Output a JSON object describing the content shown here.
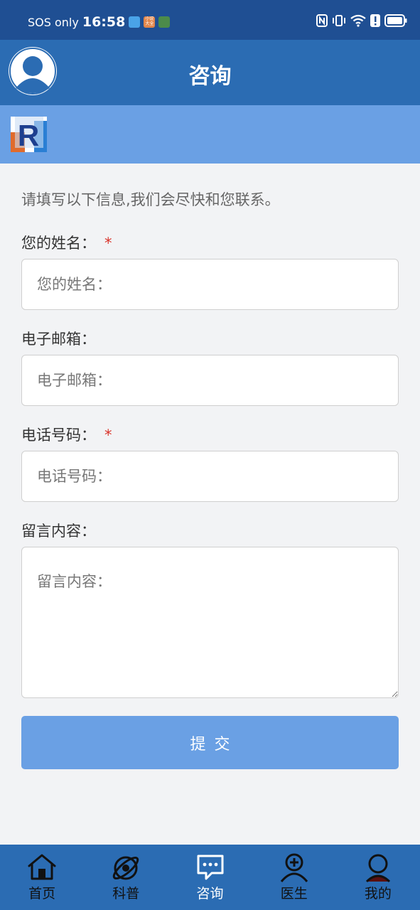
{
  "status_bar": {
    "carrier": "SOS only",
    "time": "16:58",
    "mini_app_labels": [
      "",
      "小说 大全",
      ""
    ]
  },
  "header": {
    "title": "咨询"
  },
  "logo": {
    "letter": "R"
  },
  "form": {
    "intro": "请填写以下信息,我们会尽快和您联系。",
    "required_mark": "*",
    "name": {
      "label": "您的姓名：",
      "placeholder": "您的姓名：",
      "required": true
    },
    "email": {
      "label": "电子邮箱：",
      "placeholder": "电子邮箱：",
      "required": false
    },
    "phone": {
      "label": "电话号码：",
      "placeholder": "电话号码：",
      "required": true
    },
    "message": {
      "label": "留言内容：",
      "placeholder": "留言内容：",
      "required": false
    },
    "submit_label": "提交"
  },
  "tab_bar": {
    "items": [
      {
        "label": "首页",
        "icon": "home-icon",
        "active": false
      },
      {
        "label": "科普",
        "icon": "planet-icon",
        "active": false
      },
      {
        "label": "咨询",
        "icon": "chat-icon",
        "active": true
      },
      {
        "label": "医生",
        "icon": "doctor-icon",
        "active": false
      },
      {
        "label": "我的",
        "icon": "profile-icon",
        "active": false
      }
    ]
  },
  "colors": {
    "status_bar": "#1f4f93",
    "header": "#2b6cb3",
    "logo_band": "#6aa0e4",
    "submit": "#6aa0e4",
    "required": "#d9342b",
    "page_bg": "#f2f3f5"
  }
}
